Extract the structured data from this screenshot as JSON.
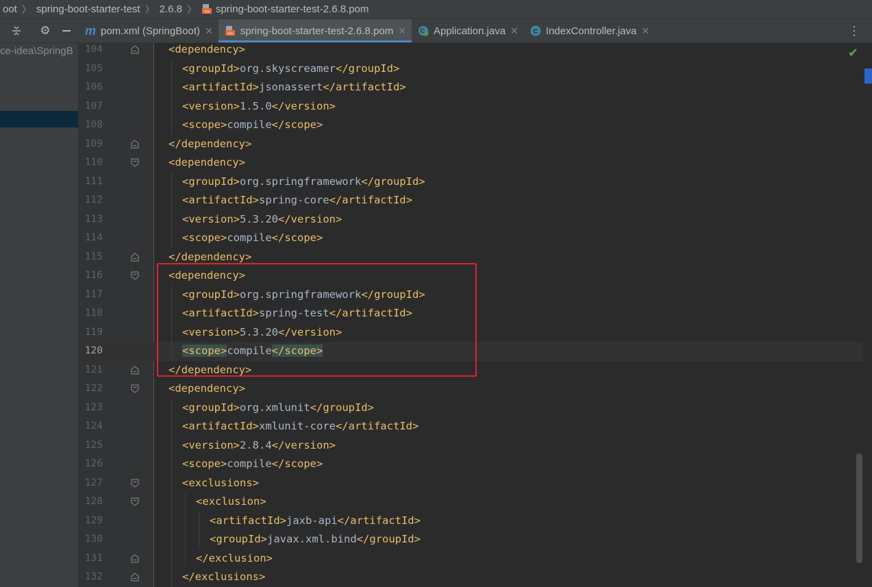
{
  "breadcrumb": [
    "oot",
    "spring-boot-starter-test",
    "2.6.8",
    "spring-boot-starter-test-2.6.8.pom"
  ],
  "toolbar": {
    "icons": [
      "collapse-all-icon",
      "gear-icon",
      "minimize-icon"
    ]
  },
  "tabs": [
    {
      "label": "pom.xml (SpringBoot)",
      "icon": "maven-icon",
      "active": false
    },
    {
      "label": "spring-boot-starter-test-2.6.8.pom",
      "icon": "pom-file-icon",
      "active": true
    },
    {
      "label": "Application.java",
      "icon": "spring-class-icon",
      "active": false
    },
    {
      "label": "IndexController.java",
      "icon": "class-icon",
      "active": false
    }
  ],
  "project": {
    "path_fragment": "ce-idea\\SpringB"
  },
  "editor": {
    "current_line": 120,
    "lines": [
      {
        "n": 104,
        "indent": 1,
        "parts": [
          [
            "tag",
            "<dependency>"
          ]
        ]
      },
      {
        "n": 105,
        "indent": 2,
        "parts": [
          [
            "tag",
            "<groupId>"
          ],
          [
            "txt",
            "org.skyscreamer"
          ],
          [
            "tag",
            "</groupId>"
          ]
        ]
      },
      {
        "n": 106,
        "indent": 2,
        "parts": [
          [
            "tag",
            "<artifactId>"
          ],
          [
            "txt",
            "jsonassert"
          ],
          [
            "tag",
            "</artifactId>"
          ]
        ]
      },
      {
        "n": 107,
        "indent": 2,
        "parts": [
          [
            "tag",
            "<version>"
          ],
          [
            "txt",
            "1.5.0"
          ],
          [
            "tag",
            "</version>"
          ]
        ]
      },
      {
        "n": 108,
        "indent": 2,
        "parts": [
          [
            "tag",
            "<scope>"
          ],
          [
            "txt",
            "compile"
          ],
          [
            "tag",
            "</scope>"
          ]
        ]
      },
      {
        "n": 109,
        "indent": 1,
        "parts": [
          [
            "tag",
            "</dependency>"
          ]
        ]
      },
      {
        "n": 110,
        "indent": 1,
        "parts": [
          [
            "tag",
            "<dependency>"
          ]
        ]
      },
      {
        "n": 111,
        "indent": 2,
        "parts": [
          [
            "tag",
            "<groupId>"
          ],
          [
            "txt",
            "org.springframework"
          ],
          [
            "tag",
            "</groupId>"
          ]
        ]
      },
      {
        "n": 112,
        "indent": 2,
        "parts": [
          [
            "tag",
            "<artifactId>"
          ],
          [
            "txt",
            "spring-core"
          ],
          [
            "tag",
            "</artifactId>"
          ]
        ]
      },
      {
        "n": 113,
        "indent": 2,
        "parts": [
          [
            "tag",
            "<version>"
          ],
          [
            "txt",
            "5.3.20"
          ],
          [
            "tag",
            "</version>"
          ]
        ]
      },
      {
        "n": 114,
        "indent": 2,
        "parts": [
          [
            "tag",
            "<scope>"
          ],
          [
            "txt",
            "compile"
          ],
          [
            "tag",
            "</scope>"
          ]
        ]
      },
      {
        "n": 115,
        "indent": 1,
        "parts": [
          [
            "tag",
            "</dependency>"
          ]
        ]
      },
      {
        "n": 116,
        "indent": 1,
        "parts": [
          [
            "tag",
            "<dependency>"
          ]
        ]
      },
      {
        "n": 117,
        "indent": 2,
        "parts": [
          [
            "tag",
            "<groupId>"
          ],
          [
            "txt",
            "org.springframework"
          ],
          [
            "tag",
            "</groupId>"
          ]
        ]
      },
      {
        "n": 118,
        "indent": 2,
        "parts": [
          [
            "tag",
            "<artifactId>"
          ],
          [
            "txt",
            "spring-test"
          ],
          [
            "tag",
            "</artifactId>"
          ]
        ]
      },
      {
        "n": 119,
        "indent": 2,
        "parts": [
          [
            "tag",
            "<version>"
          ],
          [
            "txt",
            "5.3.20"
          ],
          [
            "tag",
            "</version>"
          ]
        ]
      },
      {
        "n": 120,
        "indent": 2,
        "parts": [
          [
            "tag-hl",
            "<scope>"
          ],
          [
            "txt",
            "compile"
          ],
          [
            "tag-hl",
            "</scope>"
          ]
        ]
      },
      {
        "n": 121,
        "indent": 1,
        "parts": [
          [
            "tag",
            "</dependency>"
          ]
        ]
      },
      {
        "n": 122,
        "indent": 1,
        "parts": [
          [
            "tag",
            "<dependency>"
          ]
        ]
      },
      {
        "n": 123,
        "indent": 2,
        "parts": [
          [
            "tag",
            "<groupId>"
          ],
          [
            "txt",
            "org.xmlunit"
          ],
          [
            "tag",
            "</groupId>"
          ]
        ]
      },
      {
        "n": 124,
        "indent": 2,
        "parts": [
          [
            "tag",
            "<artifactId>"
          ],
          [
            "txt",
            "xmlunit-core"
          ],
          [
            "tag",
            "</artifactId>"
          ]
        ]
      },
      {
        "n": 125,
        "indent": 2,
        "parts": [
          [
            "tag",
            "<version>"
          ],
          [
            "txt",
            "2.8.4"
          ],
          [
            "tag",
            "</version>"
          ]
        ]
      },
      {
        "n": 126,
        "indent": 2,
        "parts": [
          [
            "tag",
            "<scope>"
          ],
          [
            "txt",
            "compile"
          ],
          [
            "tag",
            "</scope>"
          ]
        ]
      },
      {
        "n": 127,
        "indent": 2,
        "parts": [
          [
            "tag",
            "<exclusions>"
          ]
        ]
      },
      {
        "n": 128,
        "indent": 3,
        "parts": [
          [
            "tag",
            "<exclusion>"
          ]
        ]
      },
      {
        "n": 129,
        "indent": 4,
        "parts": [
          [
            "tag",
            "<artifactId>"
          ],
          [
            "txt",
            "jaxb-api"
          ],
          [
            "tag",
            "</artifactId>"
          ]
        ]
      },
      {
        "n": 130,
        "indent": 4,
        "parts": [
          [
            "tag",
            "<groupId>"
          ],
          [
            "txt",
            "javax.xml.bind"
          ],
          [
            "tag",
            "</groupId>"
          ]
        ]
      },
      {
        "n": 131,
        "indent": 3,
        "parts": [
          [
            "tag",
            "</exclusion>"
          ]
        ]
      },
      {
        "n": 132,
        "indent": 2,
        "parts": [
          [
            "tag",
            "</exclusions>"
          ]
        ]
      }
    ],
    "folds": {
      "104": "end",
      "109": "start-close",
      "110": "open",
      "115": "start-close",
      "116": "open",
      "121": "start-close",
      "122": "open",
      "127": "open",
      "128": "open",
      "131": "start-close",
      "132": "start-close"
    }
  },
  "status": {
    "inspection_icon": "check-icon"
  }
}
